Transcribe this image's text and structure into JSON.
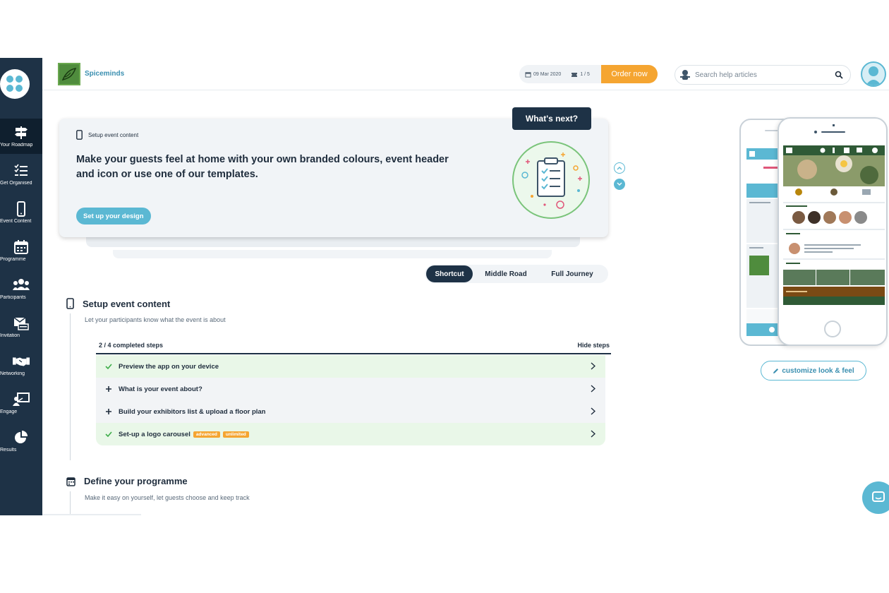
{
  "header": {
    "org_name": "Spiceminds",
    "event_date": "09 Mar 2020",
    "slots": "1 / 5",
    "order_label": "Order now",
    "search_placeholder": "Search help articles"
  },
  "sidebar": {
    "items": [
      {
        "label": "Your Roadmap",
        "icon": "roadmap-icon"
      },
      {
        "label": "Get Organised",
        "icon": "checklist-icon"
      },
      {
        "label": "Event Content",
        "icon": "phone-icon"
      },
      {
        "label": "Programme",
        "icon": "calendar-icon"
      },
      {
        "label": "Participants",
        "icon": "people-icon"
      },
      {
        "label": "Invitation",
        "icon": "invitation-icon"
      },
      {
        "label": "Networking",
        "icon": "handshake-icon"
      },
      {
        "label": "Engage",
        "icon": "presentation-icon"
      },
      {
        "label": "Results",
        "icon": "pie-chart-icon"
      }
    ]
  },
  "card": {
    "kicker": "Setup event content",
    "headline": "Make your guests feel at home with your own branded colours, event header and icon or use one of our templates.",
    "cta": "Set up your design",
    "whats_next": "What's next?"
  },
  "journey": {
    "options": [
      "Shortcut",
      "Middle Road",
      "Full Journey"
    ],
    "selected": "Shortcut"
  },
  "section1": {
    "title": "Setup event content",
    "subtitle": "Let your participants know what the event is about",
    "progress": "2 / 4 completed steps",
    "hide_label": "Hide steps",
    "steps": [
      {
        "label": "Preview the app on your device",
        "done": true
      },
      {
        "label": "What is your event about?",
        "done": false
      },
      {
        "label": "Build your exhibitors list & upload a floor plan",
        "done": false
      },
      {
        "label": "Set-up a logo carousel",
        "done": true,
        "badges": [
          "advanced",
          "unlimited"
        ]
      }
    ]
  },
  "section2": {
    "title": "Define your programme",
    "subtitle": "Make it easy on yourself, let guests choose and keep track"
  },
  "preview": {
    "customize_label": "customize look & feel"
  },
  "colors": {
    "sidebar": "#1e3246",
    "accent": "#5bb8d3",
    "order": "#f5a531",
    "done_bg": "#e9f7e8"
  }
}
